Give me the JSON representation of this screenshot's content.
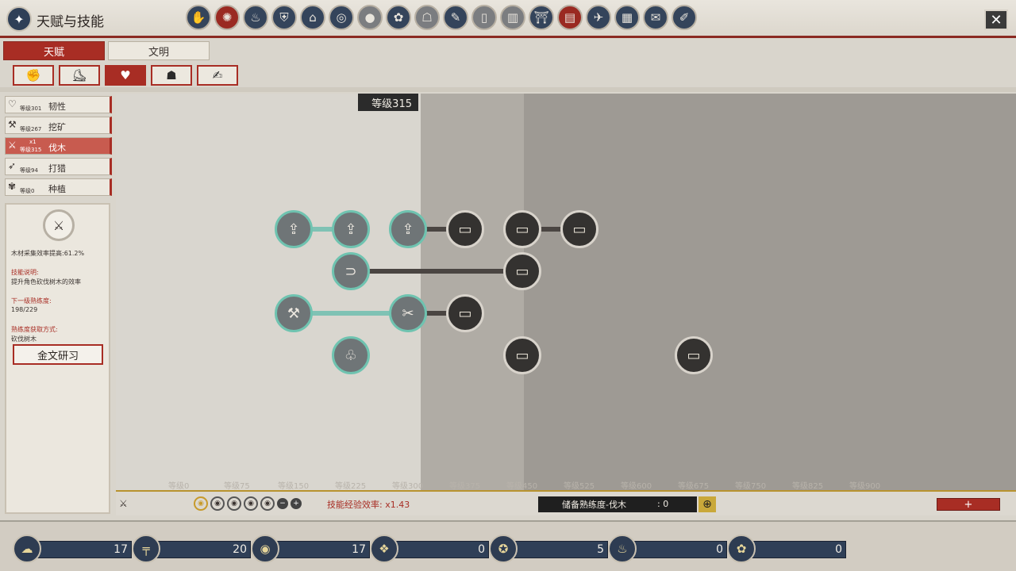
{
  "header": {
    "title": "天赋与技能",
    "nav_icons": [
      "hand-seal",
      "orb",
      "gourd",
      "armor",
      "hat",
      "target",
      "cauldron",
      "dragon",
      "cat",
      "map",
      "door",
      "building",
      "altar",
      "book",
      "crane",
      "kanji-board",
      "scroll",
      "brush"
    ]
  },
  "tabs": [
    "天赋",
    "文明"
  ],
  "subtabs": [
    "fist",
    "boot",
    "heart",
    "meditate",
    "scroll"
  ],
  "skills": [
    {
      "name": "韧性",
      "level": "等级301",
      "icon": "heart"
    },
    {
      "name": "挖矿",
      "level": "等级267",
      "icon": "pickaxe"
    },
    {
      "name": "伐木",
      "level": "等级315",
      "icon": "axe",
      "mult": "x1"
    },
    {
      "name": "打猎",
      "level": "等级94",
      "icon": "bow"
    },
    {
      "name": "种植",
      "level": "等级0",
      "icon": "sprout"
    }
  ],
  "info": {
    "bonus": "木材采集效率提高:61.2%",
    "desc_title": "技能说明:",
    "desc": "提升角色砍伐树木的效率",
    "next_title": "下一级熟练度:",
    "next": "198/229",
    "source_title": "熟练度获取方式:",
    "source": "砍伐树木",
    "study_btn": "金文研习"
  },
  "level_marker": "等级315",
  "axis": [
    "等级0",
    "等级75",
    "等级150",
    "等级225",
    "等级300",
    "等级375",
    "等级450",
    "等级525",
    "等级600",
    "等级675",
    "等级750",
    "等级825",
    "等级900"
  ],
  "bottom": {
    "exp_rate": "技能经验效率: x1.43",
    "reserve_label": "储备熟练度-伐木",
    "reserve_value": ": 0",
    "expand": "+"
  },
  "resources": [
    {
      "icon": "cloud-scroll",
      "value": "17"
    },
    {
      "icon": "bone-pillar",
      "value": "20"
    },
    {
      "icon": "spiral-coin",
      "value": "17"
    },
    {
      "icon": "gem-cluster",
      "value": "0"
    },
    {
      "icon": "swirl-coin",
      "value": "5"
    },
    {
      "icon": "cauldron",
      "value": "0"
    },
    {
      "icon": "gold-coin",
      "value": "0"
    }
  ]
}
